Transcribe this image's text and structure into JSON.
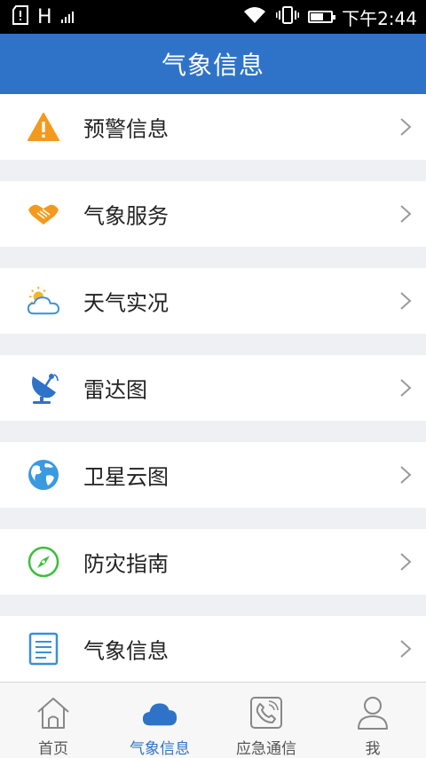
{
  "status_bar": {
    "network": "H",
    "time": "下午2:44"
  },
  "header": {
    "title": "气象信息"
  },
  "menu": {
    "items": [
      {
        "label": "预警信息",
        "icon": "warning-icon"
      },
      {
        "label": "气象服务",
        "icon": "handshake-icon"
      },
      {
        "label": "天气实况",
        "icon": "partly-cloudy-icon"
      },
      {
        "label": "雷达图",
        "icon": "radar-dish-icon"
      },
      {
        "label": "卫星云图",
        "icon": "globe-icon"
      },
      {
        "label": "防灾指南",
        "icon": "compass-icon"
      },
      {
        "label": "气象信息",
        "icon": "document-icon"
      }
    ]
  },
  "bottom_nav": {
    "items": [
      {
        "label": "首页",
        "icon": "home-icon",
        "active": false
      },
      {
        "label": "气象信息",
        "icon": "cloud-icon",
        "active": true
      },
      {
        "label": "应急通信",
        "icon": "phone-icon",
        "active": false
      },
      {
        "label": "我",
        "icon": "user-icon",
        "active": false
      }
    ]
  },
  "colors": {
    "header_bg": "#2f73c9",
    "active_nav": "#2f73c9",
    "warning": "#f39a1e",
    "service": "#f39a1e",
    "weather_sun": "#f5b52e",
    "weather_cloud": "#3a8fd8",
    "radar": "#2f73c9",
    "globe": "#3a9ae0",
    "compass": "#3bbf3b",
    "document": "#3a8fd8"
  }
}
